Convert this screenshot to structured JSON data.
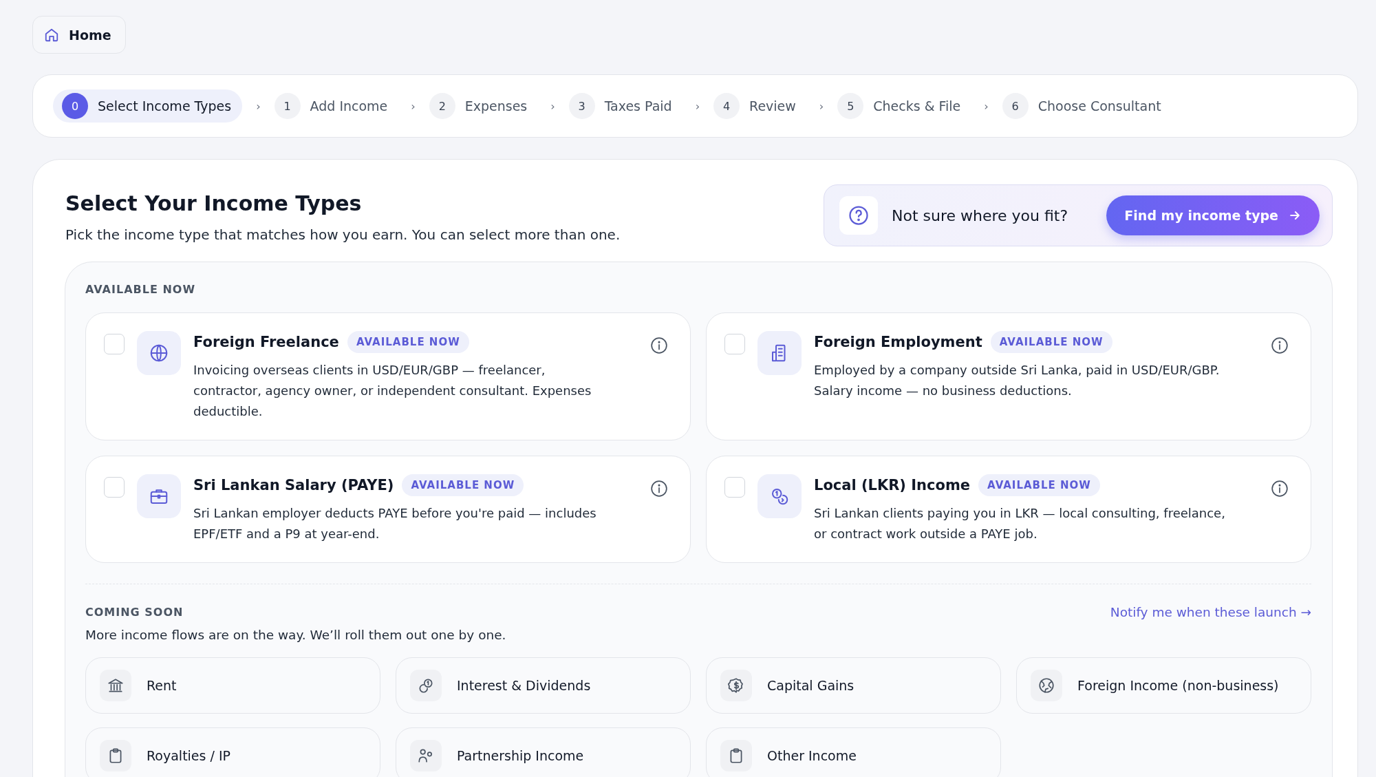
{
  "home_button": {
    "label": "Home"
  },
  "stepper": [
    {
      "number": "0",
      "label": "Select Income Types",
      "selected": true
    },
    {
      "number": "1",
      "label": "Add Income",
      "selected": false
    },
    {
      "number": "2",
      "label": "Expenses",
      "selected": false
    },
    {
      "number": "3",
      "label": "Taxes Paid",
      "selected": false
    },
    {
      "number": "4",
      "label": "Review",
      "selected": false
    },
    {
      "number": "5",
      "label": "Checks & File",
      "selected": false
    },
    {
      "number": "6",
      "label": "Choose Consultant",
      "selected": false
    }
  ],
  "stepper_separator": "›",
  "page": {
    "title": "Select Your Income Types",
    "subtitle": "Pick the income type that matches how you earn. You can select more than one."
  },
  "help_box": {
    "text": "Not sure where you fit?",
    "button": "Find my income type"
  },
  "available_section": {
    "heading": "AVAILABLE NOW",
    "cards": [
      {
        "kind": "globe",
        "title": "Foreign Freelance",
        "badge": "AVAILABLE NOW",
        "checked": false,
        "description": "Invoicing overseas clients in USD/EUR/GBP — freelancer, contractor, agency owner, or independent consultant. Expenses deductible."
      },
      {
        "kind": "building",
        "title": "Foreign Employment",
        "badge": "AVAILABLE NOW",
        "checked": false,
        "description": "Employed by a company outside Sri Lanka, paid in USD/EUR/GBP. Salary income — no business deductions."
      },
      {
        "kind": "briefcase",
        "title": "Sri Lankan Salary (PAYE)",
        "badge": "AVAILABLE NOW",
        "checked": false,
        "description": "Sri Lankan employer deducts PAYE before you're paid — includes EPF/ETF and a P9 at year-end."
      },
      {
        "kind": "coins",
        "title": "Local (LKR) Income",
        "badge": "AVAILABLE NOW",
        "checked": false,
        "description": "Sri Lankan clients paying you in LKR — local consulting, freelance, or contract work outside a PAYE job."
      }
    ]
  },
  "coming_section": {
    "heading": "COMING SOON",
    "link": "Notify me when these launch →",
    "description": "More income flows are on the way. We’ll roll them out one by one.",
    "items": [
      {
        "kind": "bank",
        "label": "Rent"
      },
      {
        "kind": "coins",
        "label": "Interest & Dividends"
      },
      {
        "kind": "dollar",
        "label": "Capital Gains"
      },
      {
        "kind": "globe",
        "label": "Foreign Income (non-business)"
      },
      {
        "kind": "clipboard",
        "label": "Royalties / IP"
      },
      {
        "kind": "people",
        "label": "Partnership Income"
      },
      {
        "kind": "clipboard",
        "label": "Other Income"
      }
    ]
  }
}
